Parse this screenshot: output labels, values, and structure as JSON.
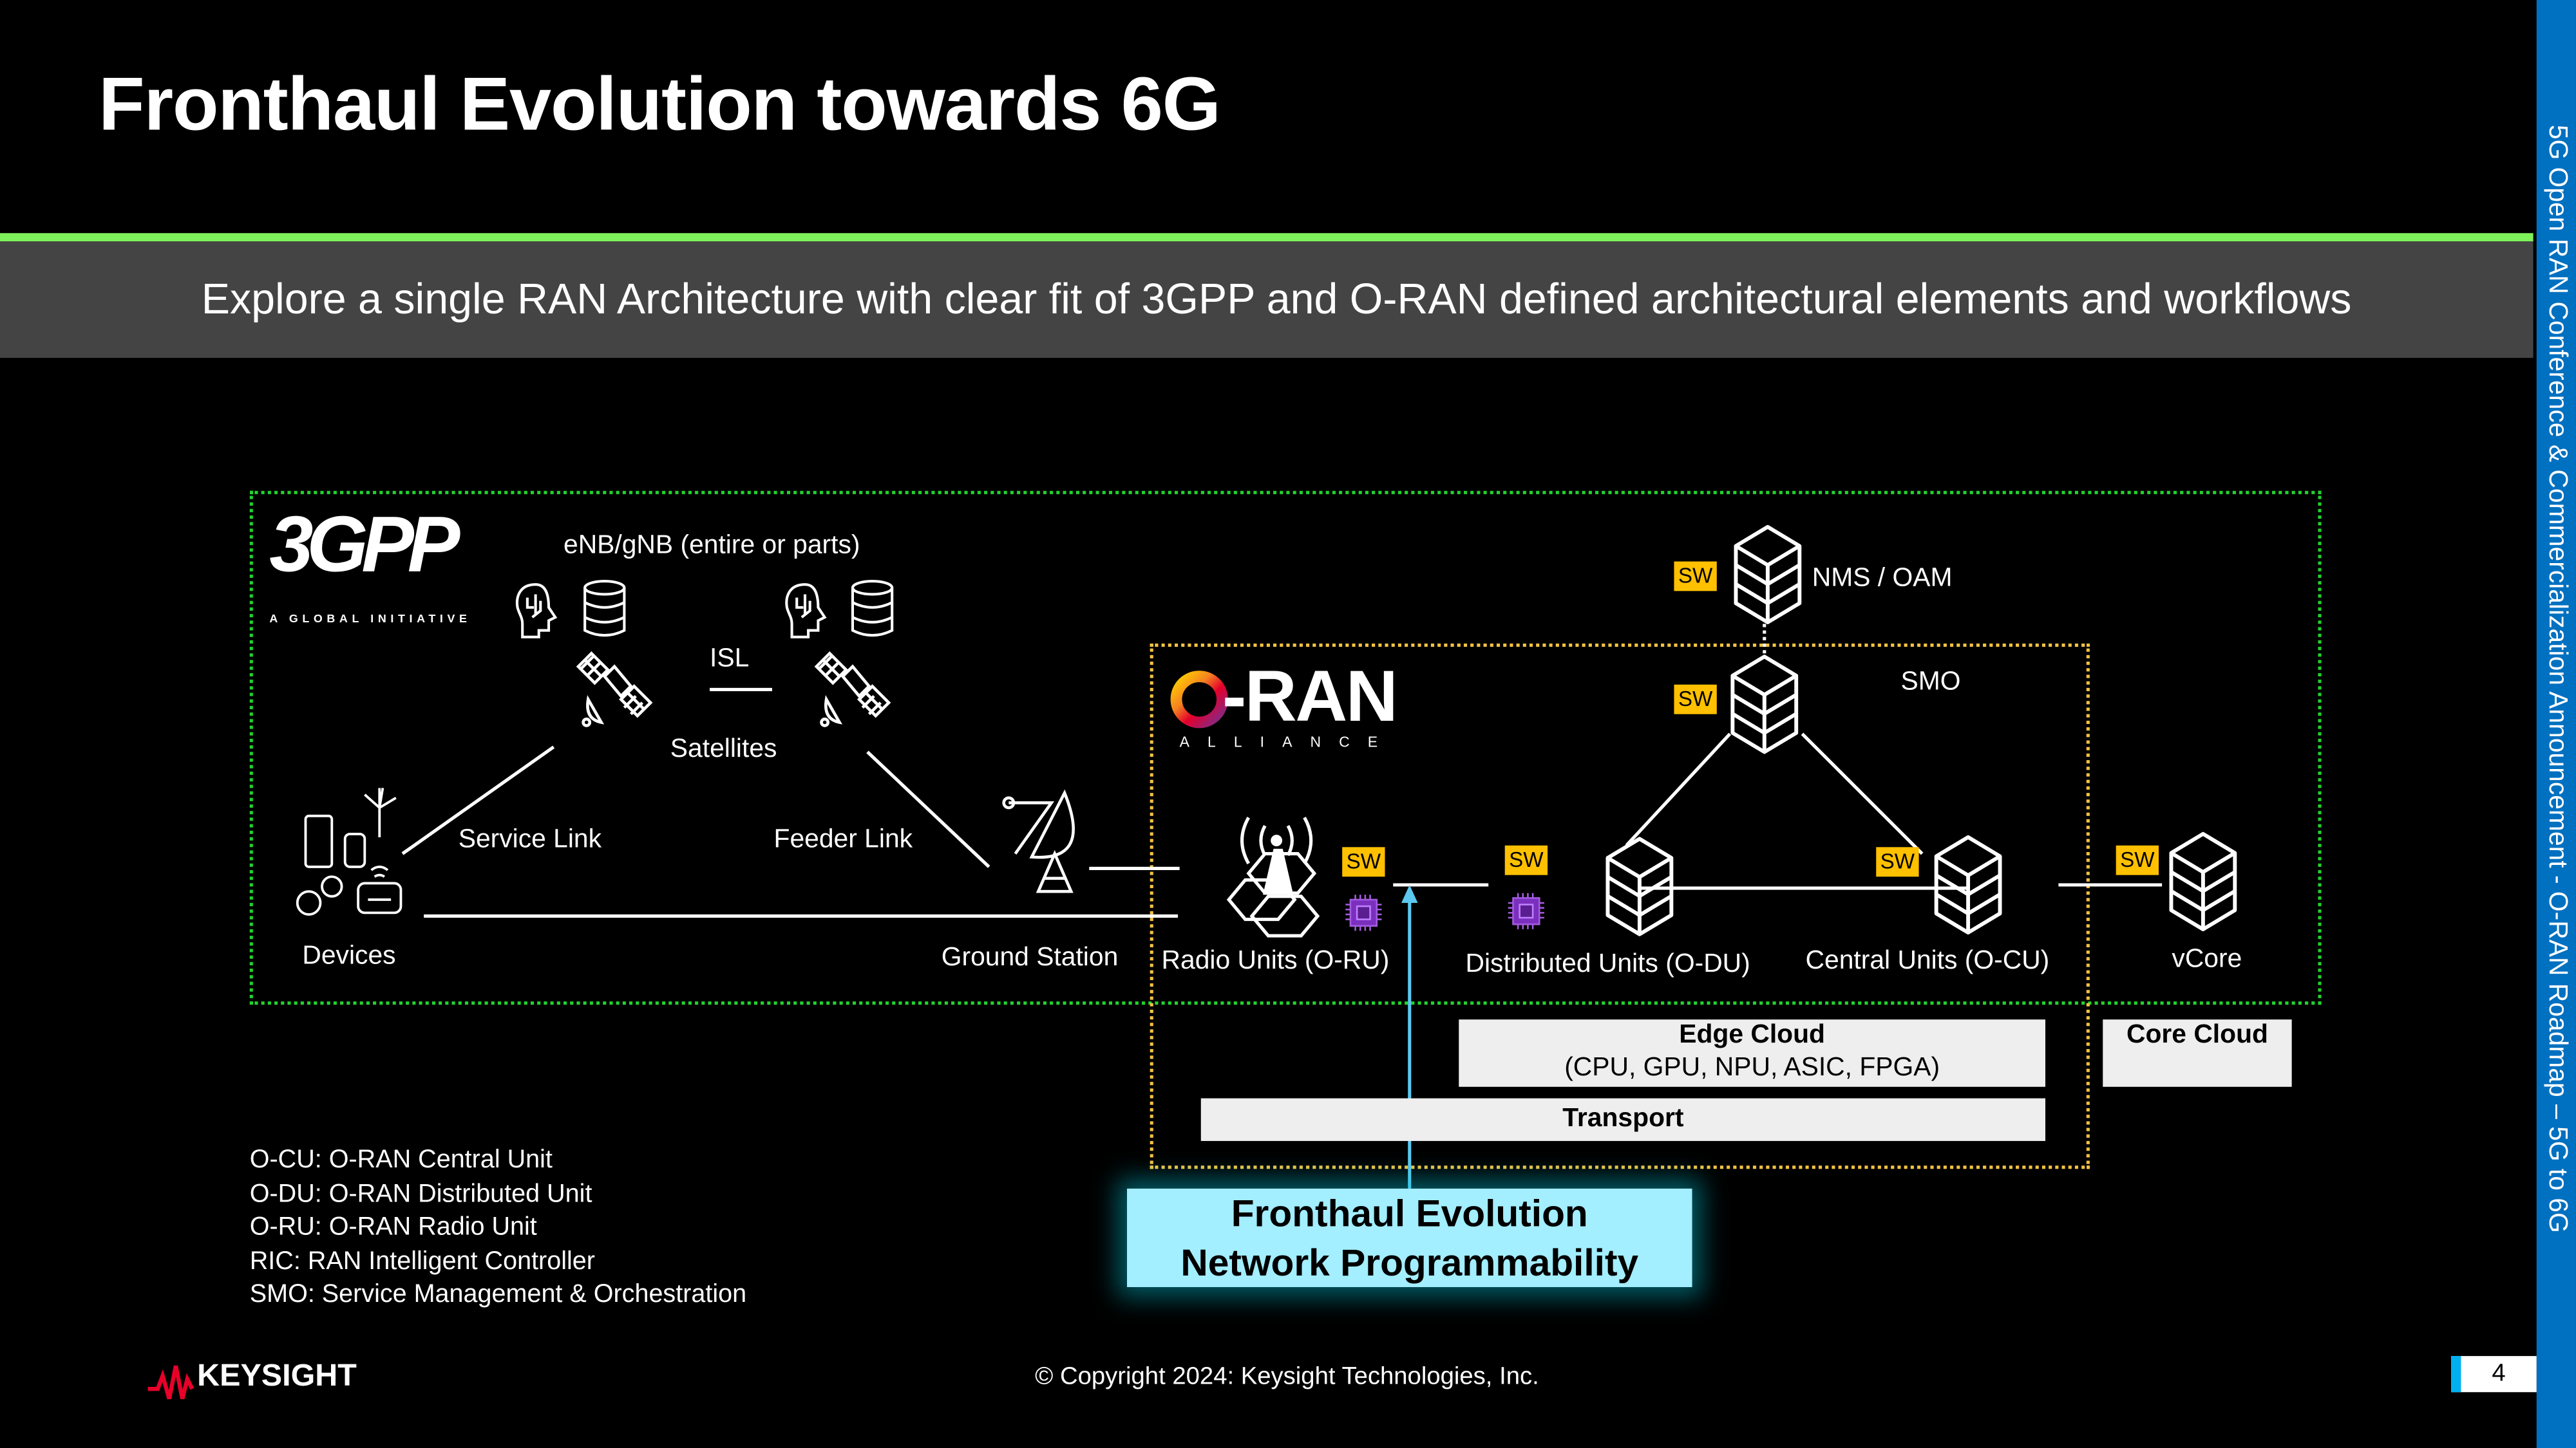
{
  "slide": {
    "title": "Fronthaul Evolution towards 6G",
    "subtitle": "Explore a single RAN Architecture with clear fit of 3GPP and O-RAN defined architectural elements and workflows",
    "sidebar_text": "5G Open RAN Conference & Commercialization Announcement - O-RAN Roadmap – 5G to 6G",
    "page_number": "4",
    "copyright": "© Copyright 2024: Keysight Technologies, Inc.",
    "brand": "KEYSIGHT"
  },
  "logos": {
    "threegpp": "3GPP",
    "threegpp_tagline": "A GLOBAL INITIATIVE",
    "oran": "O-RAN",
    "oran_tagline": "ALLIANCE"
  },
  "diagram": {
    "enb_gnb": "eNB/gNB (entire or parts)",
    "isl": "ISL",
    "satellites": "Satellites",
    "service_link": "Service Link",
    "feeder_link": "Feeder Link",
    "devices": "Devices",
    "ground_station": "Ground Station",
    "radio_units": "Radio Units (O-RU)",
    "distributed_units": "Distributed Units (O-DU)",
    "central_units": "Central Units (O-CU)",
    "vcore": "vCore",
    "nms_oam": "NMS / OAM",
    "smo": "SMO",
    "sw": "SW",
    "edge_cloud_title": "Edge Cloud",
    "edge_cloud_detail": "(CPU, GPU, NPU, ASIC, FPGA)",
    "core_cloud": "Core Cloud",
    "transport": "Transport",
    "callout_line1": "Fronthaul Evolution",
    "callout_line2": "Network Programmability"
  },
  "legend": [
    "O-CU: O-RAN Central Unit",
    "O-DU: O-RAN Distributed Unit",
    "O-RU: O-RAN Radio Unit",
    "RIC: RAN Intelligent Controller",
    "SMO: Service Management & Orchestration"
  ],
  "colors": {
    "accent_green": "#7EF25A",
    "sidebar_blue": "#0070C0",
    "sw_badge": "#FFC000",
    "chip_purple": "#7B2FBE",
    "callout": "#A3EEFF",
    "arrow": "#5BC8F0",
    "band": "#444444",
    "brand_red": "#E90029"
  }
}
